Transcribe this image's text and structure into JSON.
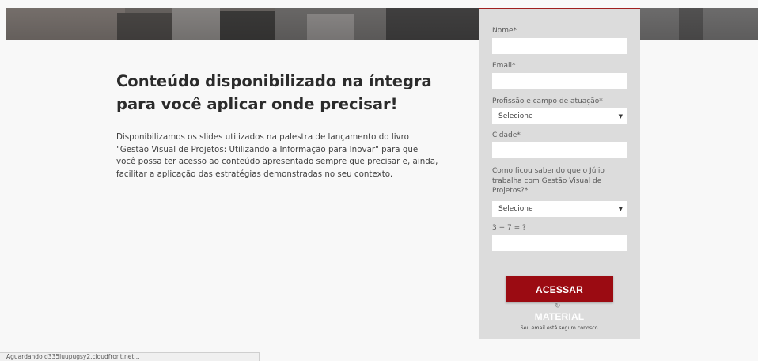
{
  "headline": {
    "line1": "Conteúdo disponibilizado na íntegra",
    "line2": "para você aplicar onde precisar!"
  },
  "description": {
    "line1": "Disponibilizamos os slides utilizados na palestra de lançamento do livro",
    "line2": "\"Gestão Visual de Projetos: Utilizando a Informação para Inovar\" para que",
    "line3": "você possa ter acesso ao conteúdo apresentado sempre que precisar e, ainda,",
    "line4": "facilitar a aplicação das estratégias demonstradas no seu contexto."
  },
  "form": {
    "nome_label": "Nome*",
    "nome_value": "",
    "email_label": "Email*",
    "email_value": "",
    "profissao_label": "Profissão e campo de atuação*",
    "profissao_selected": "Selecione",
    "cidade_label": "Cidade*",
    "cidade_value": "",
    "como_label_line1": "Como ficou sabendo que o Júlio",
    "como_label_line2": "trabalha com Gestão Visual de",
    "como_label_line3": "Projetos?*",
    "como_selected": "Selecione",
    "captcha_label": "3 + 7 = ?",
    "captcha_value": "",
    "submit_label": "ACESSAR MATERIAL",
    "refresh_glyph": "↻",
    "secure_note": "Seu email está seguro conosco."
  },
  "statusbar": {
    "text": "Aguardando d335luupugsy2.cloudfront.net..."
  },
  "colors": {
    "accent": "#9b0b12",
    "panel": "#dcdcdc",
    "background": "#f8f8f8"
  },
  "icons": {
    "select_arrow": "chevron-down-icon",
    "refresh": "refresh-icon"
  }
}
